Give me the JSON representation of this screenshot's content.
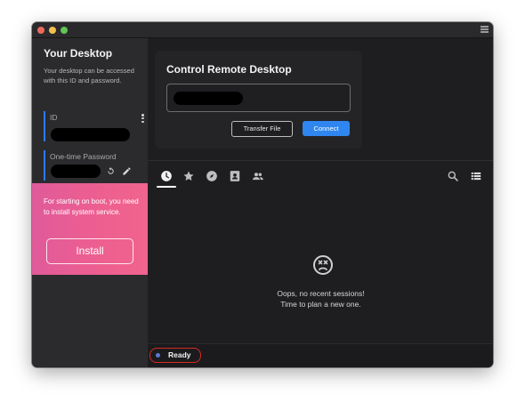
{
  "sidebar": {
    "title": "Your Desktop",
    "description": "Your desktop can be accessed with this ID and password.",
    "id_label": "ID",
    "password_label": "One-time Password"
  },
  "promo": {
    "text": "For starting on boot, you need to install system service.",
    "install_label": "Install"
  },
  "connect": {
    "title": "Control Remote Desktop",
    "transfer_label": "Transfer File",
    "connect_label": "Connect"
  },
  "tabs": [
    "recent-sessions",
    "favorites",
    "discovered",
    "address-book",
    "group"
  ],
  "empty": {
    "line1": "Oops, no recent sessions!",
    "line2": "Time to plan a new one."
  },
  "status": {
    "text": "Ready"
  },
  "colors": {
    "accent": "#2f86f0",
    "promo_gradient_start": "#e05a9a",
    "status_highlight": "#d9281f"
  }
}
